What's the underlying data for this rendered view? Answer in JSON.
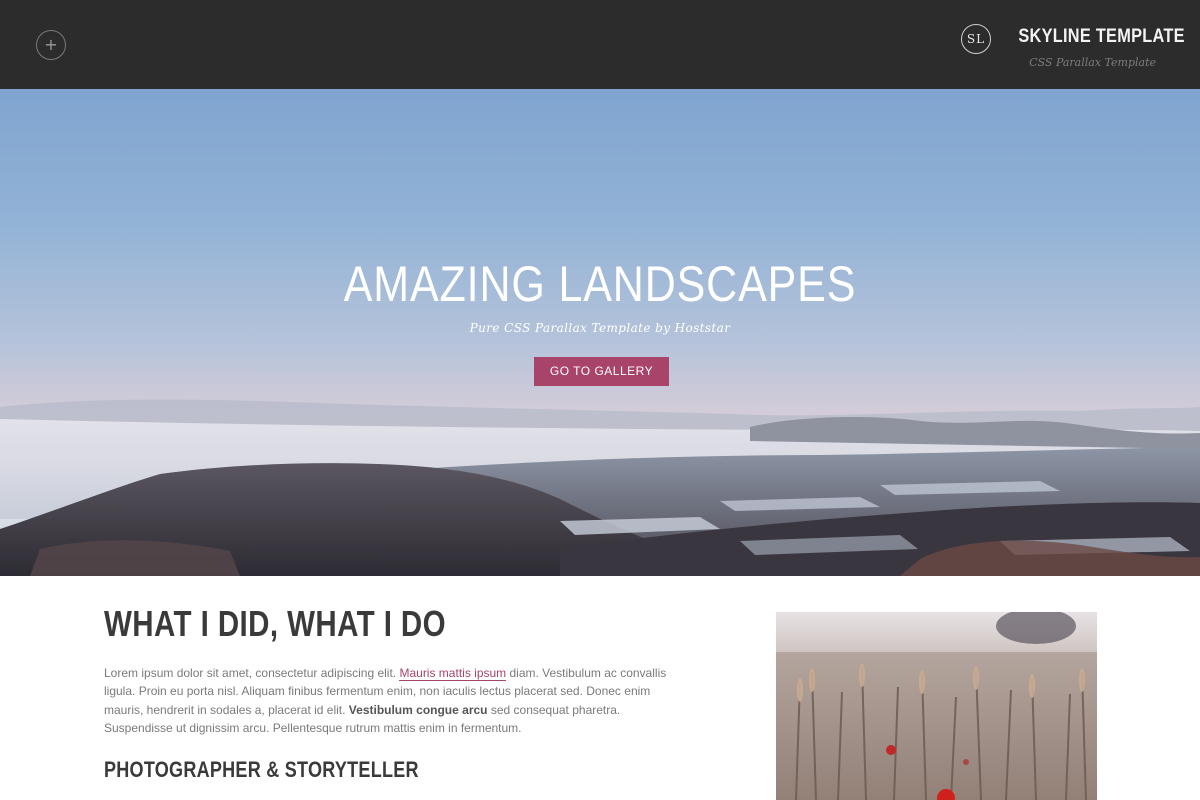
{
  "header": {
    "menu_icon": "plus-icon",
    "brand_badge": "SL",
    "brand_title": "SKYLINE TEMPLATE",
    "brand_subtitle": "CSS Parallax Template"
  },
  "hero": {
    "title": "AMAZING LANDSCAPES",
    "subtitle": "Pure CSS Parallax Template by Hoststar",
    "button_label": "GO TO GALLERY",
    "button_color": "#a8436a"
  },
  "content": {
    "heading": "WHAT I DID, WHAT I DO",
    "paragraph": {
      "part1": "Lorem ipsum dolor sit amet, consectetur adipiscing elit. ",
      "link": "Mauris mattis ipsum",
      "part2": " diam. Vestibulum ac convallis ligula. Proin eu porta nisl. Aliquam finibus fermentum enim, non iaculis lectus placerat sed. Donec enim mauris, hendrerit in sodales a, placerat id elit. ",
      "bold": "Vestibulum congue arcu",
      "part3": " sed consequat pharetra. Suspendisse ut dignissim arcu. Pellentesque rutrum mattis enim in fermentum."
    },
    "subheading": "PHOTOGRAPHER & STORYTELLER",
    "link_color": "#a8436a"
  },
  "colors": {
    "header_bg": "#2c2c2c",
    "accent": "#a8436a"
  }
}
